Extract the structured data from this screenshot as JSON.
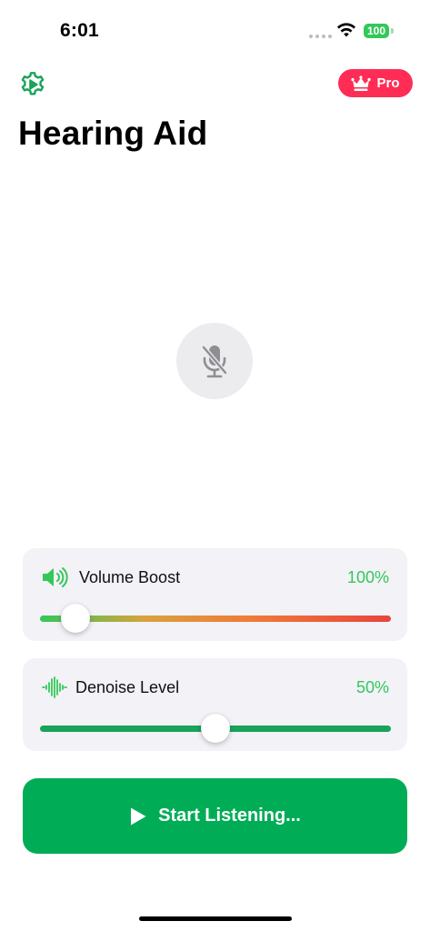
{
  "status_bar": {
    "time": "6:01",
    "battery": "100",
    "wifi_icon": "wifi-icon",
    "signal_icon": "cellular-dots-icon"
  },
  "header": {
    "settings_icon": "gear-play-icon",
    "pro_badge": {
      "label": "Pro",
      "icon": "crown-icon",
      "color": "#ff2d55"
    },
    "title": "Hearing Aid"
  },
  "mic": {
    "icon": "microphone-slash-icon",
    "state": "muted"
  },
  "controls": {
    "volume": {
      "label": "Volume Boost",
      "value_text": "100%",
      "icon": "speaker-wave-icon",
      "slider_fraction": 0.1
    },
    "denoise": {
      "label": "Denoise Level",
      "value_text": "50%",
      "icon": "waveform-icon",
      "slider_fraction": 0.5
    }
  },
  "start_button": {
    "label": "Start Listening...",
    "icon": "play-icon"
  },
  "colors": {
    "accent_green": "#00ad56",
    "value_green": "#34c759",
    "pro_red": "#ff2d55"
  }
}
